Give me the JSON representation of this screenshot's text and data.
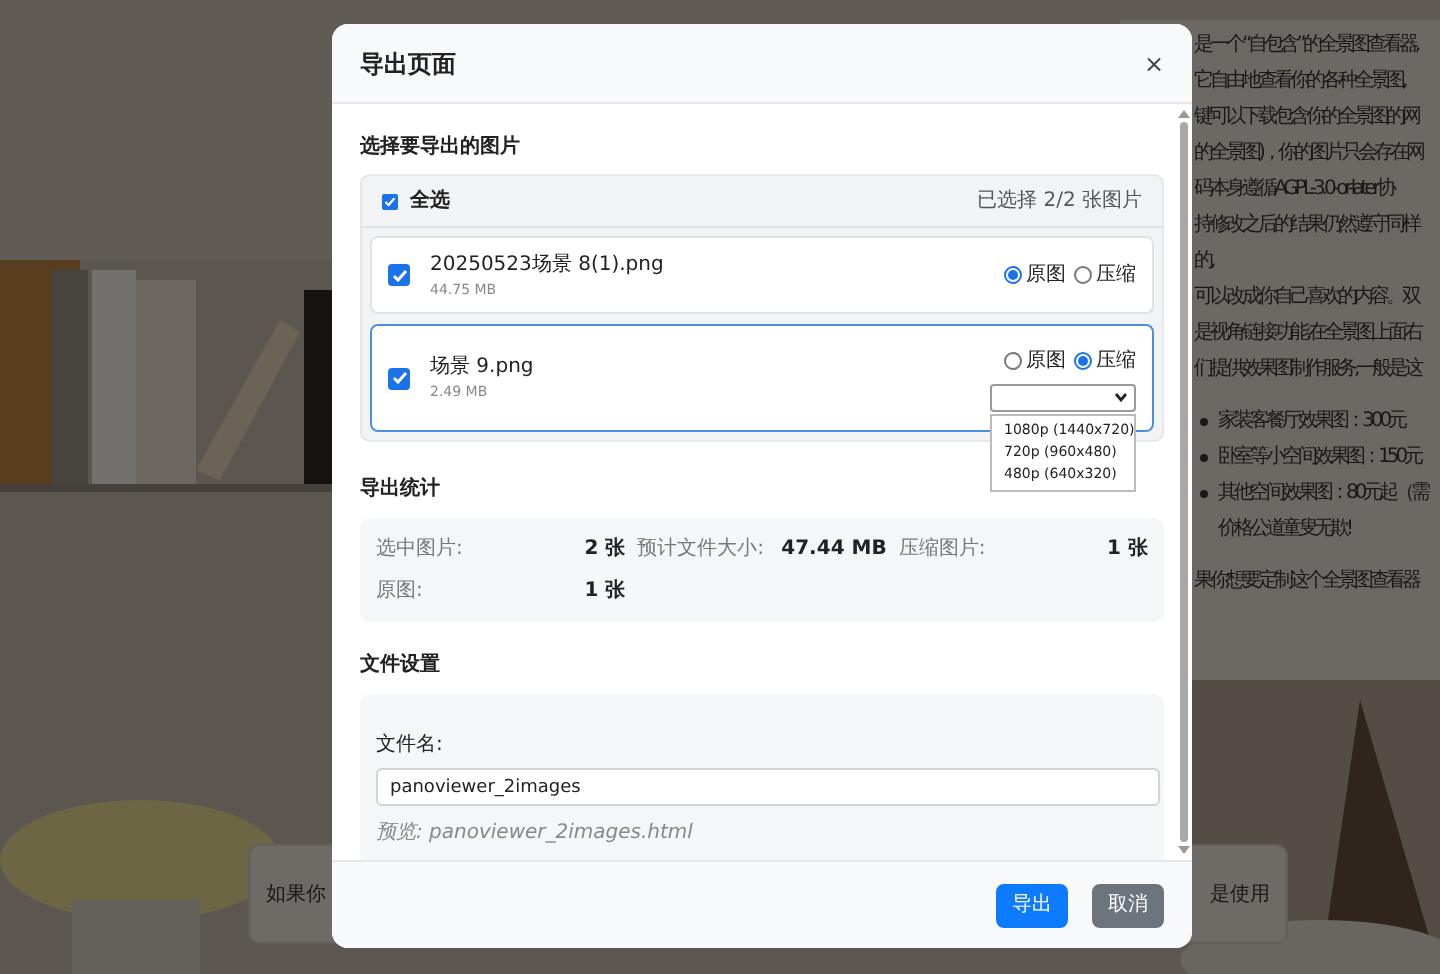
{
  "background": {
    "kind": "picture",
    "article": {
      "lines": [
        "是一个“自包含”的全景图查看器,",
        "它自由地查看你的各种全景图,",
        "键可以下载包含你的全景图的网",
        "的全景图)，你的图片只会存在网",
        "码本身遵循AGPL-3.0-or-later协",
        "持修改之后的结果仍然遵守同样",
        "的,",
        "可以改成你自己喜欢的内容。双",
        "是视角链接功能,在全景图上面右",
        "们提供效果图制作服务,一般是这"
      ],
      "bullets": [
        {
          "lines": [
            "家装客餐厅效果图：300元"
          ]
        },
        {
          "lines": [
            "卧室等小空间效果图：150元"
          ]
        },
        {
          "lines": [
            "其他空间效果图：80元起（需",
            "价格公道童叟无欺!"
          ]
        }
      ],
      "closing": "果你想要定制这个全景图查看器",
      "notice": [
        "如果你",
        "是使用"
      ]
    }
  },
  "dialog": {
    "title": "导出页面",
    "close": "×",
    "images": {
      "heading": "选择要导出的图片",
      "select_all": {
        "label": "全选",
        "checked": true
      },
      "count": "已选择 2/2 张图片",
      "items": [
        {
          "name": "20250523场景 8(1).png",
          "size": "44.75 MB",
          "checked": true,
          "focused": false,
          "options": [
            {
              "label": "原图",
              "selected": true
            },
            {
              "label": "压缩",
              "selected": false
            }
          ]
        },
        {
          "name": "场景 9.png",
          "size": "2.49 MB",
          "checked": true,
          "focused": true,
          "options": [
            {
              "label": "原图",
              "selected": false
            },
            {
              "label": "压缩",
              "selected": true
            }
          ],
          "quality": {
            "open": true,
            "options": [
              "1080p (1440x720)",
              "720p (960x480)",
              "480p (640x320)"
            ]
          }
        }
      ]
    },
    "stats": {
      "heading": "导出统计",
      "items": [
        {
          "label": "选中图片:",
          "value": "2 张"
        },
        {
          "label": "预计文件大小:",
          "value": "47.44 MB"
        },
        {
          "label": "压缩图片:",
          "value": "1 张"
        },
        {
          "label": "原图:",
          "value": "1 张"
        }
      ]
    },
    "file": {
      "heading": "文件设置",
      "label": "文件名:",
      "value": "panoviewer_2images",
      "preview": "预览: panoviewer_2images.html"
    },
    "buttons": [
      {
        "label": "导出",
        "kind": "primary"
      },
      {
        "label": "取消",
        "kind": "secondary"
      }
    ]
  }
}
